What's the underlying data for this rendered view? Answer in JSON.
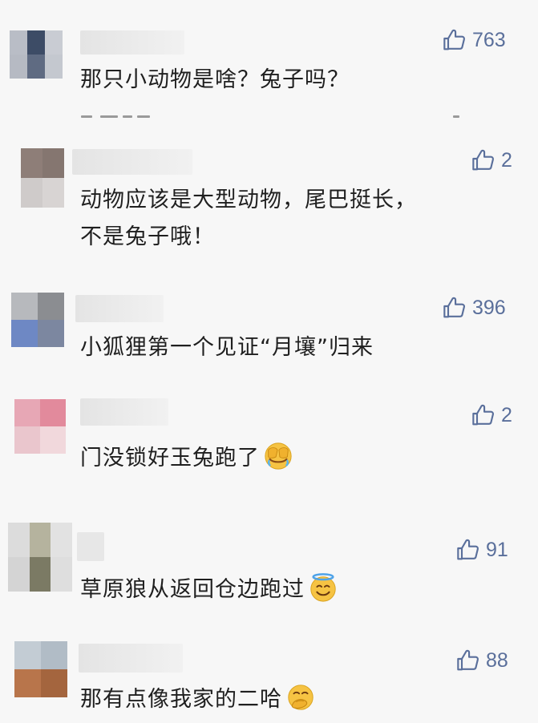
{
  "comments": [
    {
      "likes": "763",
      "text": "那只小动物是啥？兔子吗？"
    },
    {
      "likes": "2",
      "text_lines": [
        "动物应该是大型动物，尾巴挺长，",
        "不是兔子哦！"
      ]
    },
    {
      "likes": "396",
      "text": "小狐狸第一个见证“月壤”归来"
    },
    {
      "likes": "2",
      "text": "门没锁好玉兔跑了",
      "emoji": "face-palm-emoji"
    },
    {
      "likes": "91",
      "text": "草原狼从返回仓边跑过",
      "emoji": "halo-smile-emoji"
    },
    {
      "likes": "88",
      "text": "那有点像我家的二哈",
      "emoji": "hand-over-mouth-emoji"
    }
  ],
  "colors": {
    "background": "#f7f7f7",
    "like_accent": "#5a6f9b",
    "text": "#1f1f1f"
  },
  "icons": {
    "like": "thumbs-up-outline-icon"
  }
}
